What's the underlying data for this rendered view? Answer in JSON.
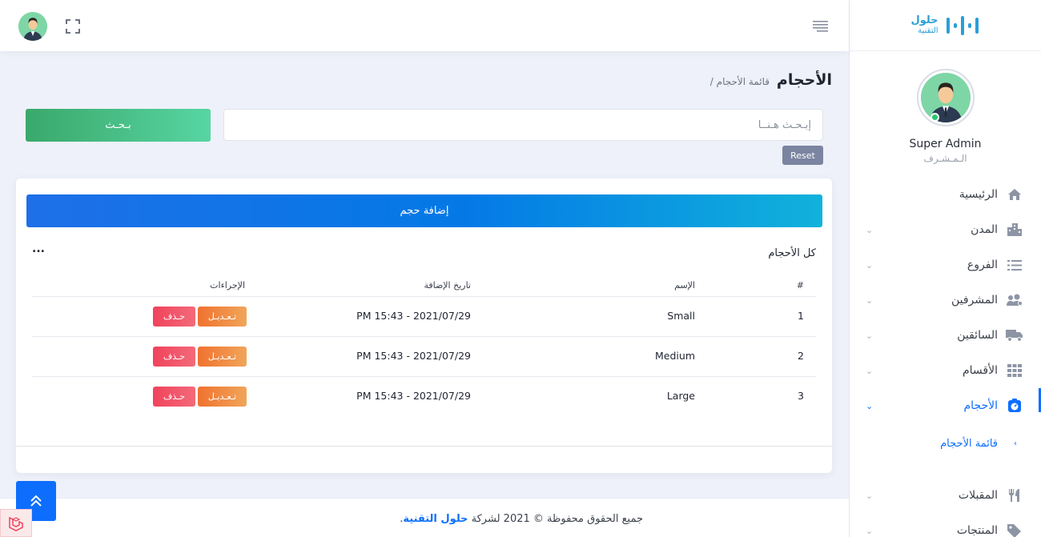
{
  "brand": {
    "name_line1": "حلول",
    "name_line2": "التقنية",
    "color": "#2a9fd8"
  },
  "header": {
    "avatar": "user-avatar",
    "fullscreen_icon": "fullscreen-icon",
    "menu_icon": "hamburger-icon"
  },
  "profile": {
    "name": "Super Admin",
    "role": "الـمـشـرف",
    "status": "online"
  },
  "sidebar": {
    "items": [
      {
        "label": "الرئيسية",
        "icon": "home-icon",
        "has_children": false,
        "active": false
      },
      {
        "label": "المدن",
        "icon": "city-icon",
        "has_children": true,
        "active": false
      },
      {
        "label": "الفروع",
        "icon": "list-icon",
        "has_children": true,
        "active": false
      },
      {
        "label": "المشرفين",
        "icon": "users-gear-icon",
        "has_children": true,
        "active": false
      },
      {
        "label": "السائقين",
        "icon": "truck-icon",
        "has_children": true,
        "active": false
      },
      {
        "label": "الأقسام",
        "icon": "grid-icon",
        "has_children": true,
        "active": false
      },
      {
        "label": "الأحجام",
        "icon": "sizes-icon",
        "has_children": true,
        "active": true
      },
      {
        "label": "المقبلات",
        "icon": "utensils-icon",
        "has_children": true,
        "active": false
      },
      {
        "label": "المنتجات",
        "icon": "tags-icon",
        "has_children": true,
        "active": false
      }
    ],
    "submenu": {
      "label": "قائمة الأحجام"
    }
  },
  "page": {
    "title": "الأحجام",
    "breadcrumb": "/ قائمة الأحجام"
  },
  "search": {
    "placeholder": "إبـحـث هـنــا",
    "value": "",
    "button_label": "بـحـث",
    "reset_label": "Reset"
  },
  "card": {
    "add_button_label": "إضافة حجم",
    "title": "كل الأحجام",
    "more_label": "..."
  },
  "table": {
    "headers": {
      "num": "#",
      "name": "الإسم",
      "date": "تاريخ الإضافة",
      "actions": "الإجراءات"
    },
    "rows": [
      {
        "num": "1",
        "name": "Small",
        "date": "PM 15:43 - 2021/07/29",
        "edit": "تـعـديـل",
        "delete": "حـذف"
      },
      {
        "num": "2",
        "name": "Medium",
        "date": "PM 15:43 - 2021/07/29",
        "edit": "تـعـديـل",
        "delete": "حـذف"
      },
      {
        "num": "3",
        "name": "Large",
        "date": "PM 15:43 - 2021/07/29",
        "edit": "تـعـديـل",
        "delete": "حـذف"
      }
    ]
  },
  "footer": {
    "text_before": "جميع الحقوق محفوظة © 2021 لشركة ",
    "company": "حلول التقنية",
    "text_after": "."
  },
  "colors": {
    "primary": "#0d6efd",
    "search_button": "#3aa86b",
    "edit_button": "#f0722f",
    "delete_button": "#f0435c",
    "reset_button": "#7b84a0"
  }
}
